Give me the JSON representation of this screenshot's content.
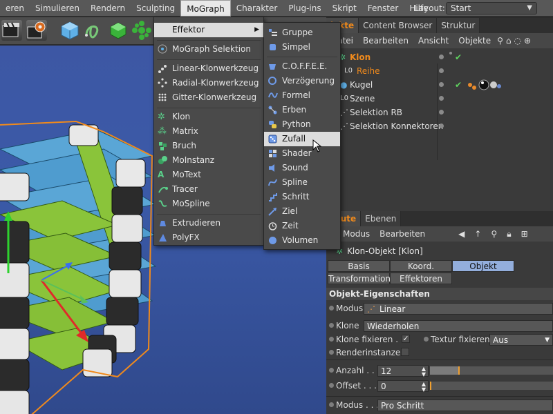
{
  "menubar": {
    "items": [
      "eren",
      "Simulieren",
      "Rendern",
      "Sculpting",
      "MoGraph",
      "Charakter",
      "Plug-ins",
      "Skript",
      "Fenster",
      "Hilfe"
    ],
    "active": "MoGraph",
    "layout_label": "Layout:",
    "layout_value": "Start"
  },
  "mograph_menu": {
    "items": [
      {
        "label": "Effektor",
        "icon": "effector-icon",
        "submenu": true
      },
      {
        "label": "MoGraph Selektion",
        "icon": "mograph-selection-icon"
      },
      {
        "label": "Linear-Klonwerkzeug",
        "icon": "linear-clone-tool-icon"
      },
      {
        "label": "Radial-Klonwerkzeug",
        "icon": "radial-clone-tool-icon"
      },
      {
        "label": "Gitter-Klonwerkzeug",
        "icon": "grid-clone-tool-icon"
      },
      {
        "label": "Klon",
        "icon": "cloner-icon"
      },
      {
        "label": "Matrix",
        "icon": "matrix-icon"
      },
      {
        "label": "Bruch",
        "icon": "fracture-icon"
      },
      {
        "label": "MoInstanz",
        "icon": "moinstance-icon"
      },
      {
        "label": "MoText",
        "icon": "motext-icon"
      },
      {
        "label": "Tracer",
        "icon": "tracer-icon"
      },
      {
        "label": "MoSpline",
        "icon": "mospline-icon"
      },
      {
        "label": "Extrudieren",
        "icon": "extrude-icon"
      },
      {
        "label": "PolyFX",
        "icon": "polyfx-icon"
      }
    ]
  },
  "effektor_submenu": {
    "items": [
      {
        "label": "Gruppe",
        "icon": "group-effector-icon"
      },
      {
        "label": "Simpel",
        "icon": "plain-effector-icon"
      },
      {
        "label": "C.O.F.F.E.E.",
        "icon": "coffee-effector-icon"
      },
      {
        "label": "Verzögerung",
        "icon": "delay-effector-icon"
      },
      {
        "label": "Formel",
        "icon": "formula-effector-icon"
      },
      {
        "label": "Erben",
        "icon": "inheritance-effector-icon"
      },
      {
        "label": "Python",
        "icon": "python-effector-icon"
      },
      {
        "label": "Zufall",
        "icon": "random-effector-icon"
      },
      {
        "label": "Shader",
        "icon": "shader-effector-icon"
      },
      {
        "label": "Sound",
        "icon": "sound-effector-icon"
      },
      {
        "label": "Spline",
        "icon": "spline-effector-icon"
      },
      {
        "label": "Schritt",
        "icon": "step-effector-icon"
      },
      {
        "label": "Ziel",
        "icon": "target-effector-icon"
      },
      {
        "label": "Zeit",
        "icon": "time-effector-icon"
      },
      {
        "label": "Volumen",
        "icon": "volume-effector-icon"
      }
    ],
    "highlighted": "Zufall"
  },
  "object_manager": {
    "tabs": [
      "jekte",
      "Content Browser",
      "Struktur"
    ],
    "menu": [
      "Datei",
      "Bearbeiten",
      "Ansicht",
      "Objekte"
    ],
    "objects": [
      {
        "name": "Klon",
        "color": "#f08a1c"
      },
      {
        "name": "Reihe",
        "color": "#f08a1c"
      },
      {
        "name": "Kugel",
        "color": "#e2e2e2"
      },
      {
        "name": "Szene",
        "color": "#e2e2e2"
      },
      {
        "name": "Selektion RB",
        "color": "#e2e2e2"
      },
      {
        "name": "Selektion Konnektoren",
        "color": "#e2e2e2"
      }
    ]
  },
  "attribute_manager": {
    "tabs": [
      "ibute",
      "Ebenen"
    ],
    "menu": [
      "Modus",
      "Bearbeiten"
    ],
    "title": "Klon-Objekt [Klon]",
    "sub_tabs": [
      "Basis",
      "Koord.",
      "Objekt",
      "Transformation",
      "Effektoren"
    ],
    "active_sub_tab": "Objekt",
    "section_title": "Objekt-Eigenschaften",
    "modus_label": "Modus",
    "modus_value": "Linear",
    "klone_label": "Klone",
    "klone_value": "Wiederholen",
    "klone_fixieren_label": "Klone fixieren . . .",
    "klone_fixieren_checked": true,
    "textur_fixieren_label": "Textur fixieren",
    "textur_fixieren_value": "Aus",
    "renderinstanzen_label": "Renderinstanzen",
    "anzahl_label": "Anzahl . . .",
    "anzahl_value": "12",
    "anzahl_slider_fraction": 0.24,
    "offset_label": "Offset . . .",
    "offset_value": "0",
    "modus2_label": "Modus . . .",
    "modus2_value": "Pro Schritt"
  },
  "colors": {
    "accent_orange": "#f08a1c",
    "active_tab_blue": "#93aedc",
    "viewport_blue": "#3b5aa8",
    "menu_highlight": "#dcdcdc"
  }
}
